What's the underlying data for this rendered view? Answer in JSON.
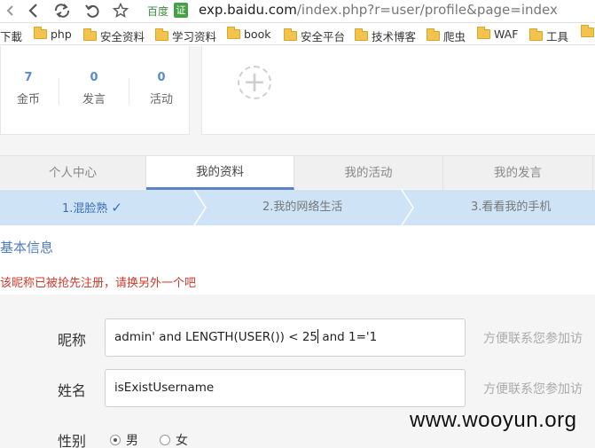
{
  "browser": {
    "url_host": "exp.baidu.com",
    "url_path": "/index.php?r=user/profile&page=index",
    "site_label": "百度",
    "cert_badge": "证"
  },
  "bookmarks": [
    {
      "label": "下載",
      "folder": false
    },
    {
      "label": "php",
      "folder": true
    },
    {
      "label": "安全资料",
      "folder": true
    },
    {
      "label": "学习资料",
      "folder": true
    },
    {
      "label": "book",
      "folder": true
    },
    {
      "label": "安全平台",
      "folder": true
    },
    {
      "label": "技术博客",
      "folder": true
    },
    {
      "label": "爬虫",
      "folder": true
    },
    {
      "label": "WAF",
      "folder": true
    },
    {
      "label": "工具",
      "folder": true
    }
  ],
  "stats": [
    {
      "value": "7",
      "label": "金币"
    },
    {
      "value": "0",
      "label": "发言"
    },
    {
      "value": "0",
      "label": "活动"
    }
  ],
  "tabs": [
    {
      "label": "个人中心",
      "active": false
    },
    {
      "label": "我的资料",
      "active": true
    },
    {
      "label": "我的活动",
      "active": false
    },
    {
      "label": "我的发言",
      "active": false
    }
  ],
  "steps": [
    {
      "label": "1.混脸熟",
      "active": true
    },
    {
      "label": "2.我的网络生活",
      "active": false
    },
    {
      "label": "3.看看我的手机",
      "active": false
    }
  ],
  "section_title": "基本信息",
  "error_message": "该昵称已被抢先注册，请换另外一个吧",
  "form": {
    "nickname_label": "昵称",
    "nickname_value_before_caret": "admin' and LENGTH(USER()) < 25",
    "nickname_value_after_caret": " and 1='1",
    "nickname_hint": "方便联系您参加访",
    "name_label": "姓名",
    "name_value": "isExistUsername",
    "name_hint": "方便联系您参加访",
    "gender_label": "性别",
    "gender_options": [
      {
        "label": "男",
        "selected": true
      },
      {
        "label": "女",
        "selected": false
      }
    ]
  },
  "watermark": "www.wooyun.org",
  "colors": {
    "accent_blue": "#4f7cc2",
    "step_bg": "#cfe3f6",
    "error_red": "#d23b2b",
    "stat_number": "#5b8ad0"
  }
}
